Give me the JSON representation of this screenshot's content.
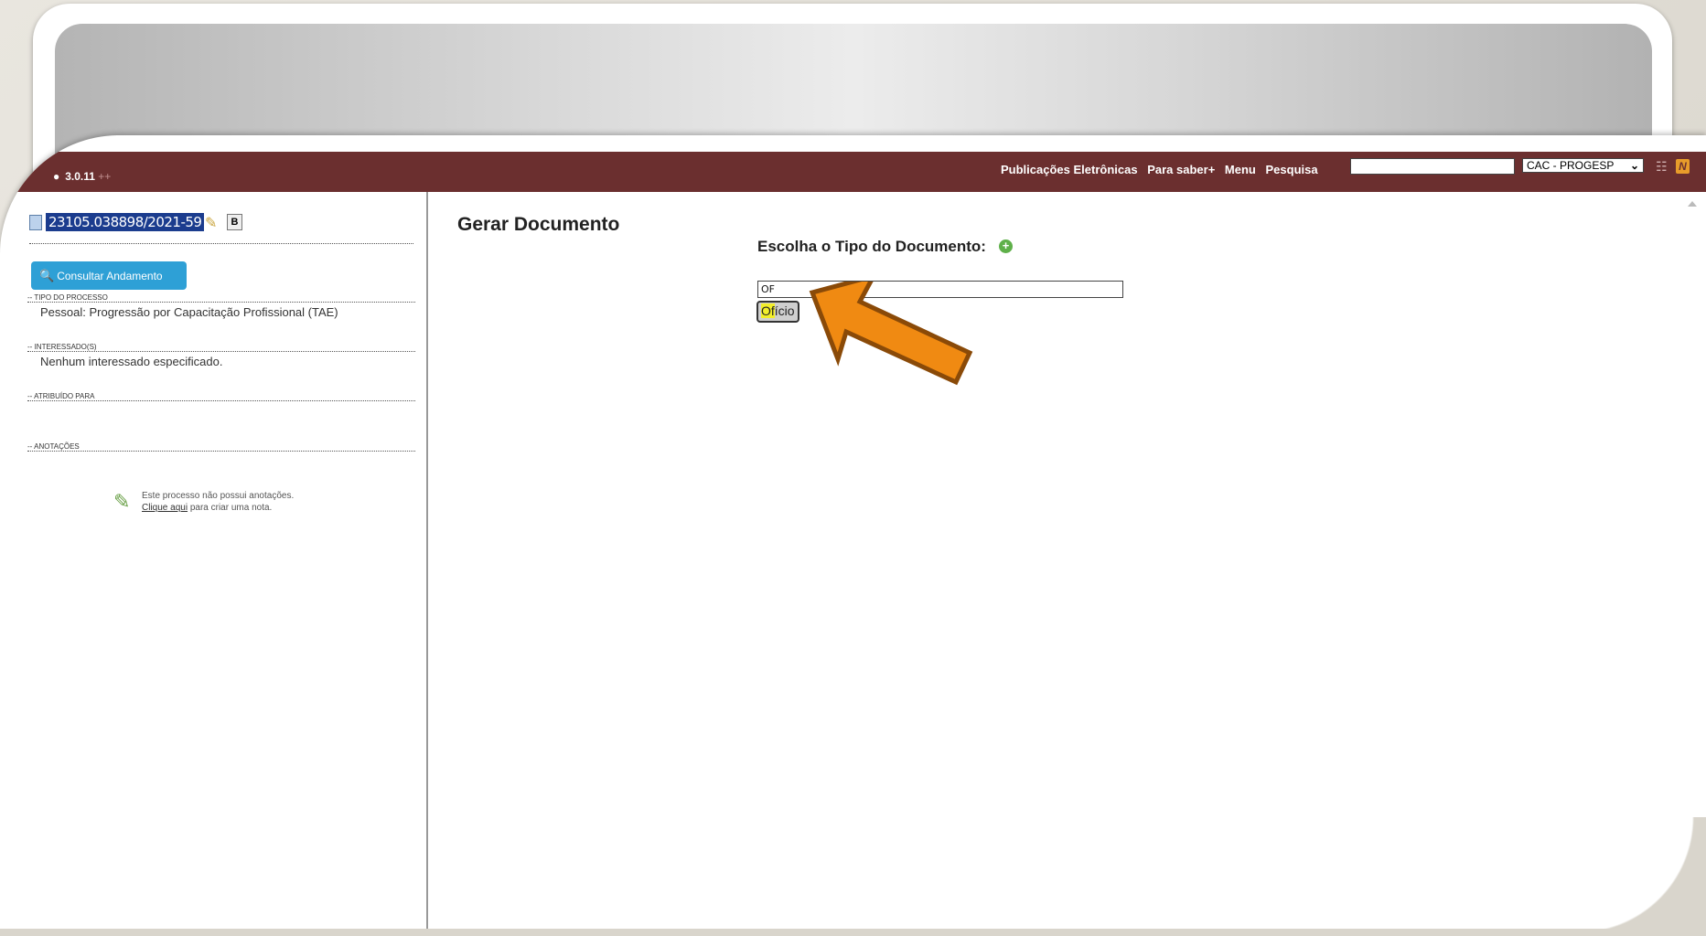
{
  "header": {
    "version": "3.0.11",
    "version_suffix": "++",
    "nav": [
      "Publicações Eletrônicas",
      "Para saber+",
      "Menu",
      "Pesquisa"
    ],
    "search_value": "",
    "unit_select": "CAC - PROGESP",
    "n_label": "N"
  },
  "process": {
    "number": "23105.038898/2021-59",
    "b_label": "B",
    "consult_button": "Consultar Andamento",
    "tipo_label": "TIPO DO PROCESSO",
    "tipo_value": "Pessoal: Progressão por Capacitação Profissional (TAE)",
    "interessados_label": "INTERESSADO(S)",
    "interessados_value": "Nenhum interessado especificado.",
    "atribuido_label": "ATRIBUÍDO PARA",
    "anotacoes_label": "ANOTAÇÕES",
    "note_text_1": "Este processo não possui anotações.",
    "note_link": "Clique aqui",
    "note_text_2": "para criar uma nota."
  },
  "main": {
    "title": "Gerar Documento",
    "choose_label": "Escolha o Tipo do Documento:",
    "filter_value": "OF",
    "option_highlight": "Of",
    "option_rest": "ício"
  },
  "colors": {
    "topbar": "#6b2f2f",
    "consult_button": "#2ea0d6",
    "arrow": "#f08a12",
    "highlight": "#f2ee2a"
  }
}
